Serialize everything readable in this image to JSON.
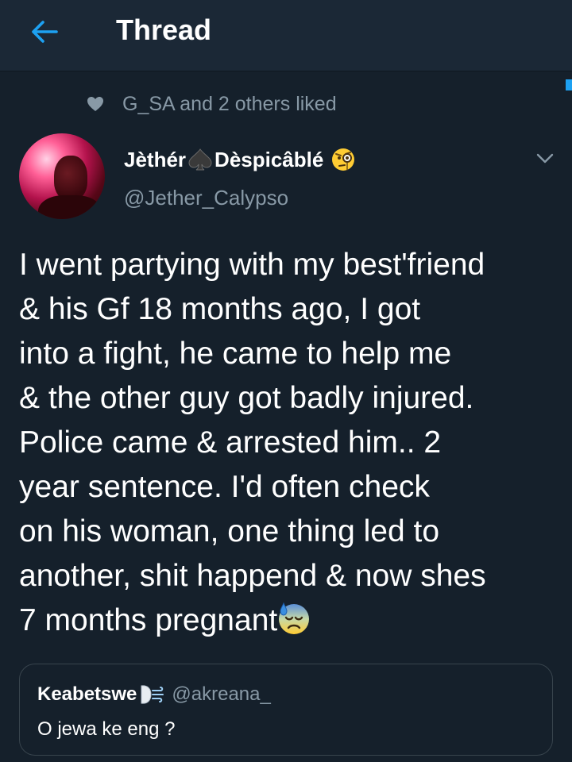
{
  "header": {
    "title": "Thread",
    "back_icon": "arrow-left-icon"
  },
  "social_context": {
    "text": "G_SA and 2 others liked",
    "icon": "heart-icon"
  },
  "tweet": {
    "author_name_part1": "Jèthér",
    "author_name_part2": "Dèspicâblé",
    "author_emoji_1": "spade-icon",
    "author_emoji_2": "face-with-monocle-icon",
    "handle": "@Jether_Calypso",
    "menu_icon": "chevron-down-icon",
    "text_lines": [
      "I went partying with my best'friend",
      "& his Gf 18 months ago, I got",
      "into a fight, he came to help me",
      "& the other guy got badly injured.",
      "Police came & arrested him.. 2",
      "year sentence. I'd often check",
      "on his woman, one thing led to",
      "another, shit happend & now shes",
      "7 months pregnant"
    ],
    "trailing_emoji": "anxious-face-with-sweat-icon"
  },
  "quoted_tweet": {
    "author_name": "Keabetswe",
    "author_emoji": "wind-face-icon",
    "handle": "@akreana_",
    "text": "O jewa ke eng ?"
  },
  "colors": {
    "background": "#15202b",
    "header_background": "#1b2836",
    "accent": "#1da1f2",
    "secondary_text": "#8899a6",
    "border": "#38444d"
  }
}
